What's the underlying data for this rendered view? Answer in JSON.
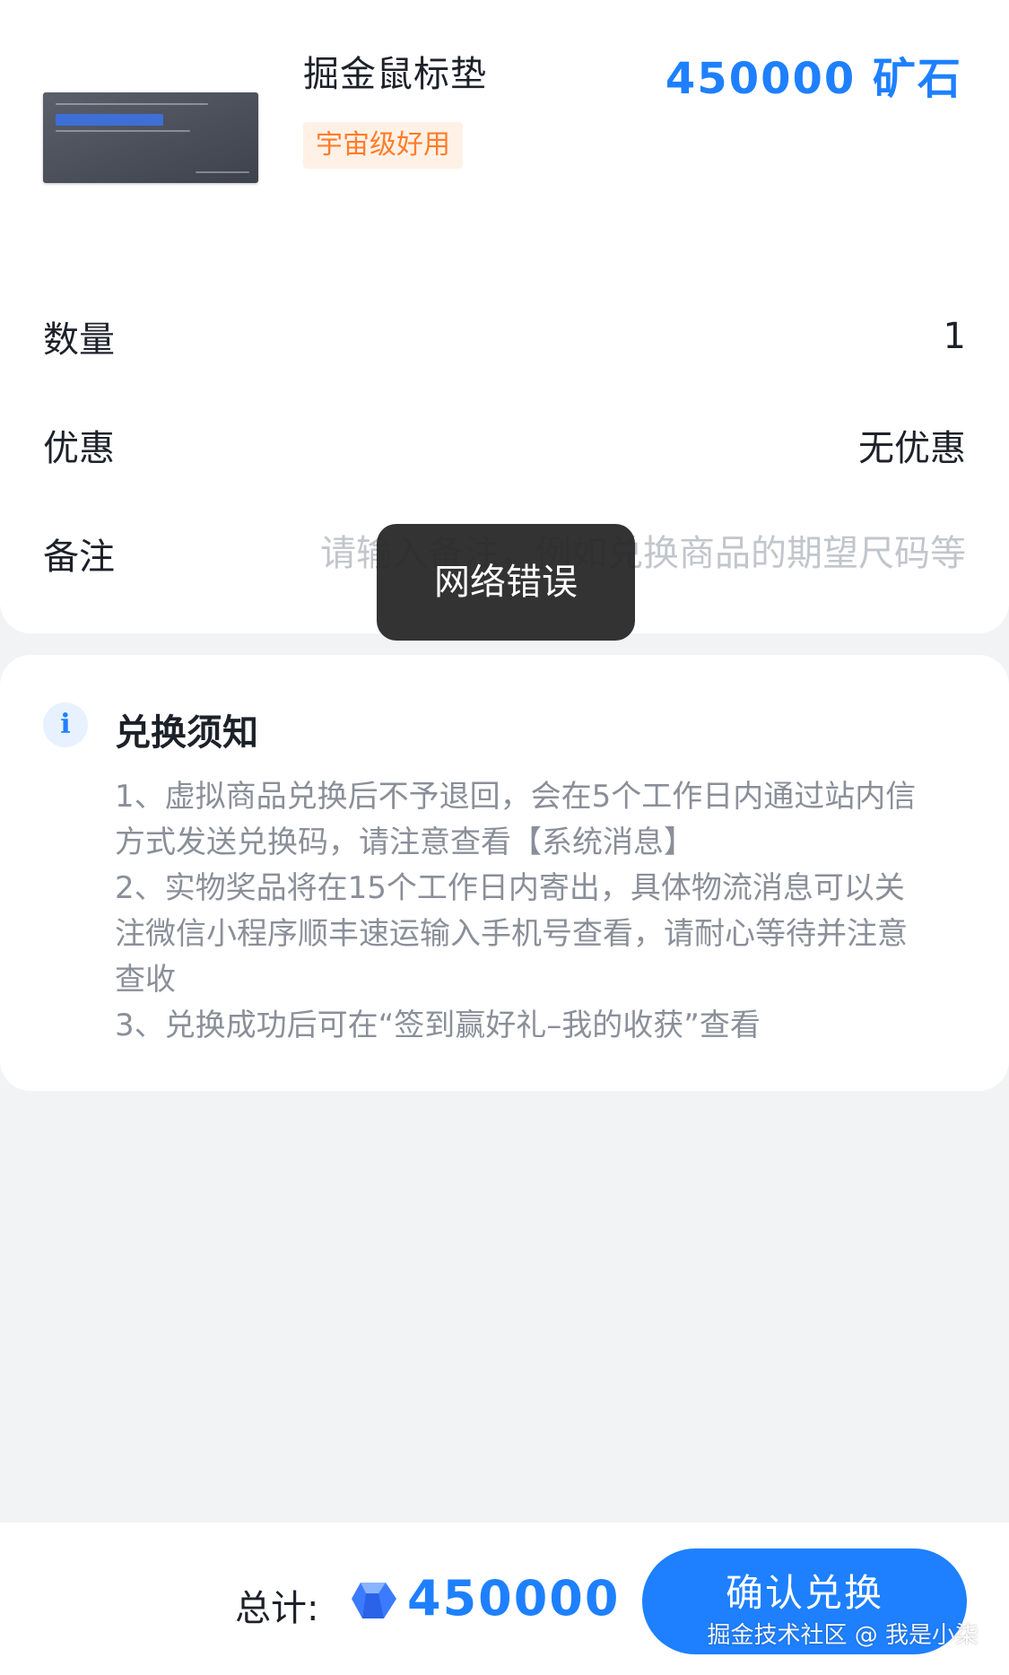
{
  "product": {
    "name": "掘金鼠标垫",
    "price": "450000 矿石",
    "tag": "宇宙级好用"
  },
  "form": {
    "quantity_label": "数量",
    "quantity_value": "1",
    "discount_label": "优惠",
    "discount_value": "无优惠",
    "remark_label": "备注",
    "remark_placeholder": "请输入备注，例如兑换商品的期望尺码等"
  },
  "toast": {
    "message": "网络错误"
  },
  "notice": {
    "icon": "info-icon",
    "title": "兑换须知",
    "lines": [
      "1、虚拟商品兑换后不予退回，会在5个工作日内通过站内信",
      "方式发送兑换码，请注意查看【系统消息】",
      "2、实物奖品将在15个工作日内寄出，具体物流消息可以关",
      "注微信小程序顺丰速运输入手机号查看，请耐心等待并注意",
      "查收",
      "3、兑换成功后可在“签到赢好礼–我的收获”查看"
    ]
  },
  "footer": {
    "total_label": "总计:",
    "ore_icon": "ore-gem-icon",
    "total_amount": "450000",
    "confirm_label": "确认兑换",
    "watermark": "掘金技术社区 @ 我是小柒"
  },
  "colors": {
    "accent": "#1e80ff",
    "tag_text": "#ff7d2a",
    "tag_bg": "#fff1e6",
    "page_bg": "#f2f3f5"
  }
}
